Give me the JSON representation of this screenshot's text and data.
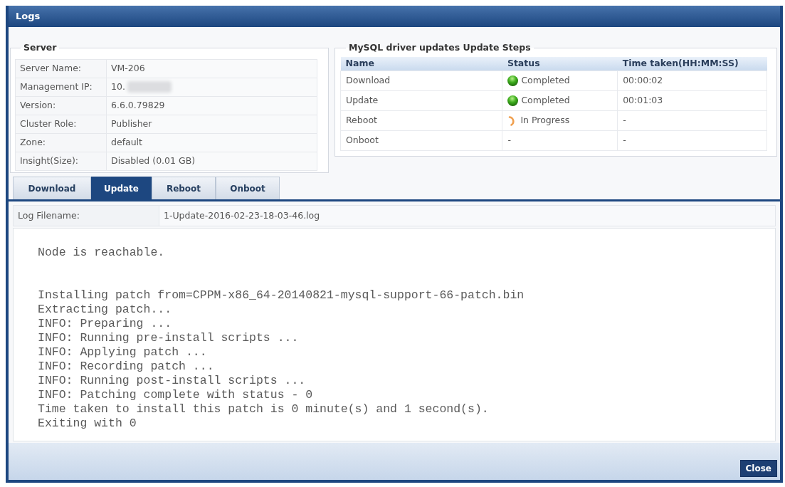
{
  "window": {
    "title": "Logs"
  },
  "server": {
    "legend": "Server",
    "rows": [
      {
        "label": "Server Name:",
        "value": "VM-206",
        "redacted": false
      },
      {
        "label": "Management IP:",
        "value": "10.",
        "redacted": true
      },
      {
        "label": "Version:",
        "value": "6.6.0.79829",
        "redacted": false
      },
      {
        "label": "Cluster Role:",
        "value": "Publisher",
        "redacted": false
      },
      {
        "label": "Zone:",
        "value": "default",
        "redacted": false
      },
      {
        "label": "Insight(Size):",
        "value": "Disabled (0.01 GB)",
        "redacted": false
      }
    ]
  },
  "update_steps": {
    "legend": "MySQL driver updates Update Steps",
    "columns": [
      "Name",
      "Status",
      "Time taken(HH:MM:SS)"
    ],
    "rows": [
      {
        "name": "Download",
        "status": {
          "kind": "completed",
          "text": "Completed"
        },
        "time": "00:00:02"
      },
      {
        "name": "Update",
        "status": {
          "kind": "completed",
          "text": "Completed"
        },
        "time": "00:01:03"
      },
      {
        "name": "Reboot",
        "status": {
          "kind": "in_progress",
          "text": "In Progress"
        },
        "time": "-"
      },
      {
        "name": "Onboot",
        "status": {
          "kind": "none",
          "text": "-"
        },
        "time": "-"
      }
    ]
  },
  "tabs": [
    {
      "label": "Download",
      "selected": false
    },
    {
      "label": "Update",
      "selected": true
    },
    {
      "label": "Reboot",
      "selected": false
    },
    {
      "label": "Onboot",
      "selected": false
    }
  ],
  "log": {
    "filename_label": "Log Filename:",
    "filename": "1-Update-2016-02-23-18-03-46.log",
    "paragraphs": [
      [
        "Node is reachable."
      ],
      [
        "Installing patch from=CPPM-x86_64-20140821-mysql-support-66-patch.bin",
        "Extracting patch...",
        "INFO: Preparing ...",
        "INFO: Running pre-install scripts ...",
        "INFO: Applying patch ...",
        "INFO: Recording patch ...",
        "INFO: Running post-install scripts ...",
        "INFO: Patching complete with status - 0",
        "Time taken to install this patch is 0 minute(s) and 1 second(s).",
        "Exiting with 0"
      ]
    ]
  },
  "buttons": [
    {
      "label": "Close"
    }
  ]
}
